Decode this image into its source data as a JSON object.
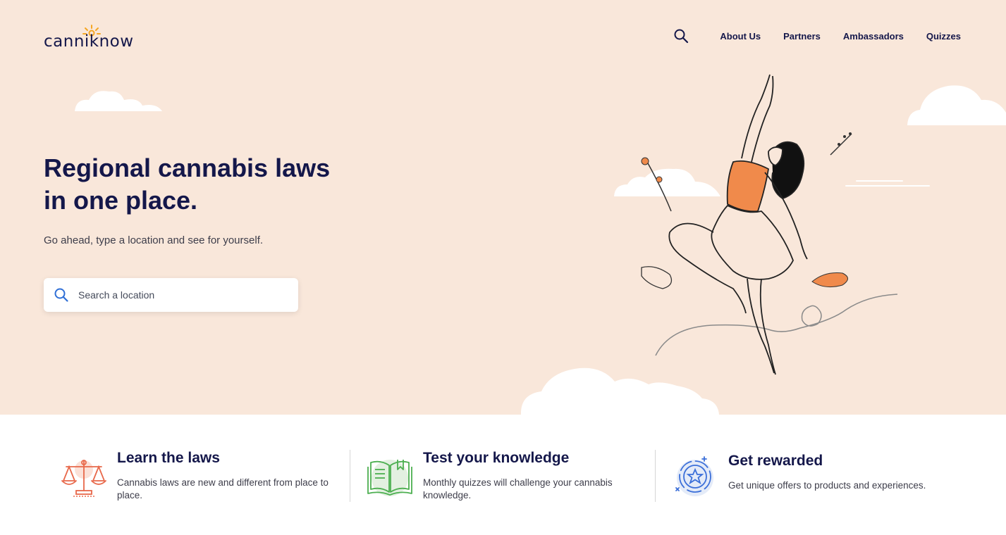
{
  "brand": {
    "logo_text": "canniknow",
    "accent": "#f5a623"
  },
  "nav": {
    "search_icon": "search-icon",
    "links": [
      {
        "label": "About Us"
      },
      {
        "label": "Partners"
      },
      {
        "label": "Ambassadors"
      },
      {
        "label": "Quizzes"
      }
    ]
  },
  "hero": {
    "title_line1": "Regional cannabis laws",
    "title_line2": "in one place.",
    "subtitle": "Go ahead, type a location and see for yourself.",
    "search": {
      "placeholder": "Search a location",
      "value": "",
      "icon": "search-icon"
    },
    "background": "#f9e7da",
    "illustration": "woman-jumping-illustration"
  },
  "features": [
    {
      "icon": "scales-icon",
      "title": "Learn the laws",
      "description": "Cannabis laws are new and different from place to place.",
      "color": "#e8684a"
    },
    {
      "icon": "book-icon",
      "title": "Test your knowledge",
      "description": "Monthly quizzes will challenge your cannabis knowledge.",
      "color": "#4caf50"
    },
    {
      "icon": "star-badge-icon",
      "title": "Get rewarded",
      "description": "Get unique offers to products and experiences.",
      "color": "#3b6fd9"
    }
  ],
  "colors": {
    "navy": "#14174a",
    "orange": "#f08a4b"
  }
}
